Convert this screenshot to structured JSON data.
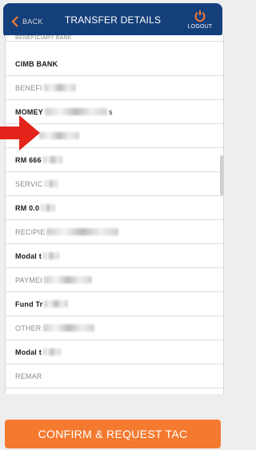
{
  "header": {
    "back_label": "BACK",
    "title": "TRANSFER DETAILS",
    "logout_label": "LOGOUT"
  },
  "details": {
    "rows": [
      {
        "label": "BENEFICIARY BANK"
      },
      {
        "label": "CIMB BANK"
      },
      {
        "label": "BENEFI"
      },
      {
        "label": "MOMEY"
      },
      {
        "label": "s"
      },
      {
        "label": "RM 666"
      },
      {
        "label": "SERVIC"
      },
      {
        "label": "RM 0.0"
      },
      {
        "label": "RECIPIE"
      },
      {
        "label": "Modal t"
      },
      {
        "label": "PAYMEI"
      },
      {
        "label": "Fund Tr"
      },
      {
        "label": "OTHER"
      },
      {
        "label": "Modal t"
      },
      {
        "label": "REMAR"
      }
    ]
  },
  "footer": {
    "confirm_label": "CONFIRM & REQUEST TAC"
  },
  "colors": {
    "header_bg": "#153f7a",
    "accent_orange": "#f47a30",
    "annotation_arrow": "#e3241b"
  }
}
